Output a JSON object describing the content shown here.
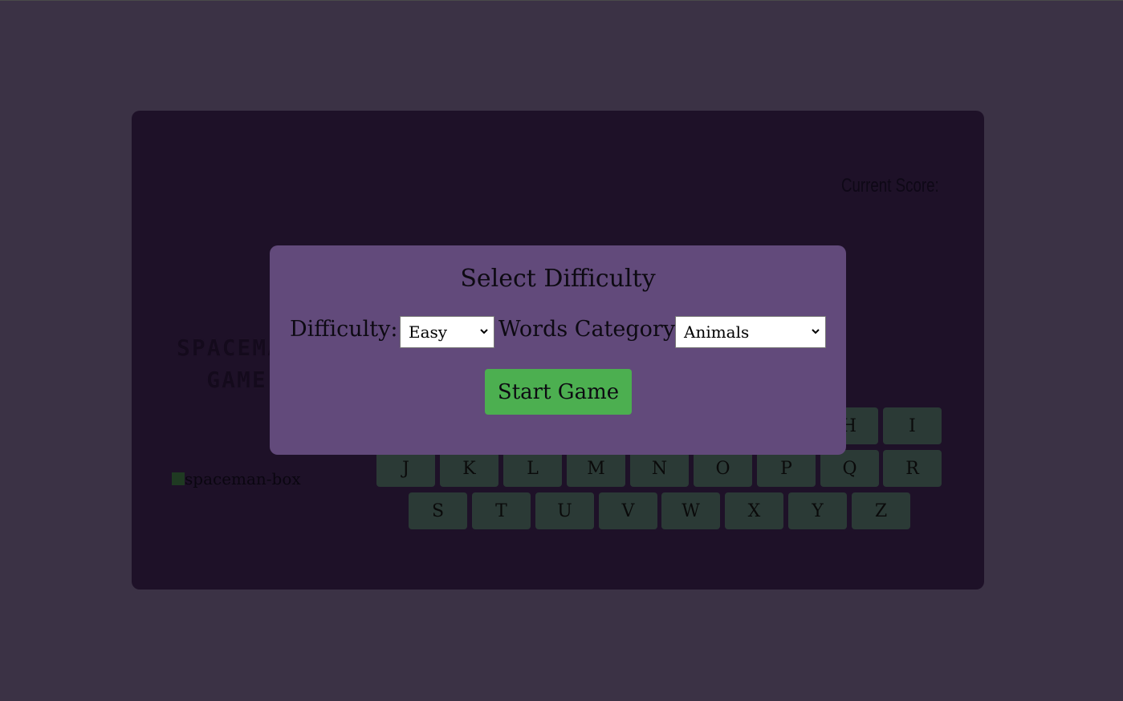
{
  "score": {
    "label": "Current Score:"
  },
  "game": {
    "title_line1": "SPACEMAN",
    "title_line2": "GAME",
    "image_alt": "spaceman-box"
  },
  "keyboard": {
    "row1_visible": [
      "H",
      "I"
    ],
    "row2": [
      "J",
      "K",
      "L",
      "M",
      "N",
      "O",
      "P",
      "Q",
      "R"
    ],
    "row3": [
      "S",
      "T",
      "U",
      "V",
      "W",
      "X",
      "Y",
      "Z"
    ]
  },
  "modal": {
    "title": "Select Difficulty",
    "difficulty_label": "Difficulty:",
    "difficulty_value": "Easy",
    "category_label": "Words Category:",
    "category_value": "Animals",
    "start_label": "Start Game"
  },
  "colors": {
    "page_bg": "#3b3245",
    "panel_bg": "#1e1128",
    "modal_bg": "#624a7b",
    "key_bg": "#2b3a36",
    "start_bg": "#4caf50"
  },
  "icons": {
    "select_arrow": "chevron-down-icon",
    "broken_image": "broken-image-icon"
  }
}
